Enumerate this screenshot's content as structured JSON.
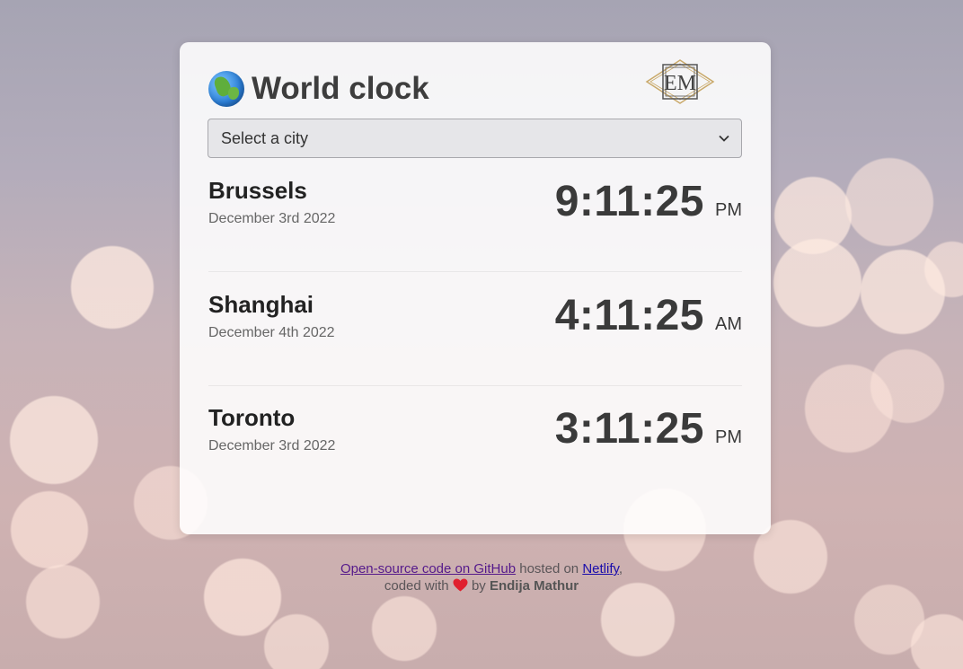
{
  "header": {
    "title": "World clock",
    "globe_icon": "globe-emoji",
    "logo_text": "EM"
  },
  "city_select": {
    "value": "Select a city"
  },
  "cities": [
    {
      "name": "Brussels",
      "date": "December 3rd 2022",
      "time": "9:11:25",
      "ampm": "PM"
    },
    {
      "name": "Shanghai",
      "date": "December 4th 2022",
      "time": "4:11:25",
      "ampm": "AM"
    },
    {
      "name": "Toronto",
      "date": "December 3rd 2022",
      "time": "3:11:25",
      "ampm": "PM"
    }
  ],
  "footer": {
    "github_link": "Open-source code on GitHub",
    "hosted_text": "hosted on",
    "netlify_link": "Netlify",
    "comma": ",",
    "coded_with": "coded with",
    "by_text": "by",
    "author": "Endija Mathur"
  },
  "colors": {
    "heart": "#e0202e",
    "link": "#1a0dab",
    "visited_link": "#551a8b",
    "logo_gold": "#c9a96a"
  }
}
